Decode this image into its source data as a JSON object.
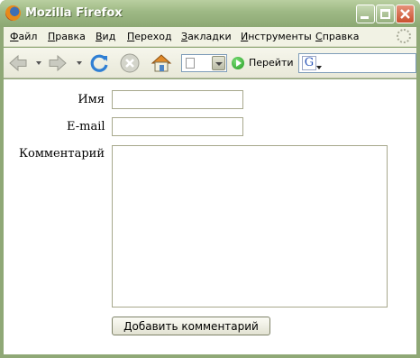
{
  "window": {
    "title": "Mozilla Firefox"
  },
  "menu": [
    {
      "accel": "Ф",
      "rest": "айл"
    },
    {
      "accel": "П",
      "rest": "равка"
    },
    {
      "accel": "В",
      "rest": "ид"
    },
    {
      "accel": "П",
      "rest": "ереход"
    },
    {
      "accel": "З",
      "rest": "акладки"
    },
    {
      "accel": "И",
      "rest": "нструменты"
    },
    {
      "accel": "С",
      "rest": "правка"
    }
  ],
  "toolbar": {
    "go_label": "Перейти",
    "url_value": "",
    "search_value": "",
    "icons": [
      "back-icon",
      "forward-icon",
      "reload-icon",
      "stop-icon",
      "home-icon"
    ]
  },
  "form": {
    "name_label": "Имя",
    "name_value": "",
    "email_label": "E-mail",
    "email_value": "",
    "comment_label": "Комментарий",
    "comment_value": "",
    "submit_label": "Добавить комментарий"
  },
  "colors": {
    "titlebar": "#9db884",
    "frame": "#8fa876",
    "field_border": "#a7a88c"
  }
}
